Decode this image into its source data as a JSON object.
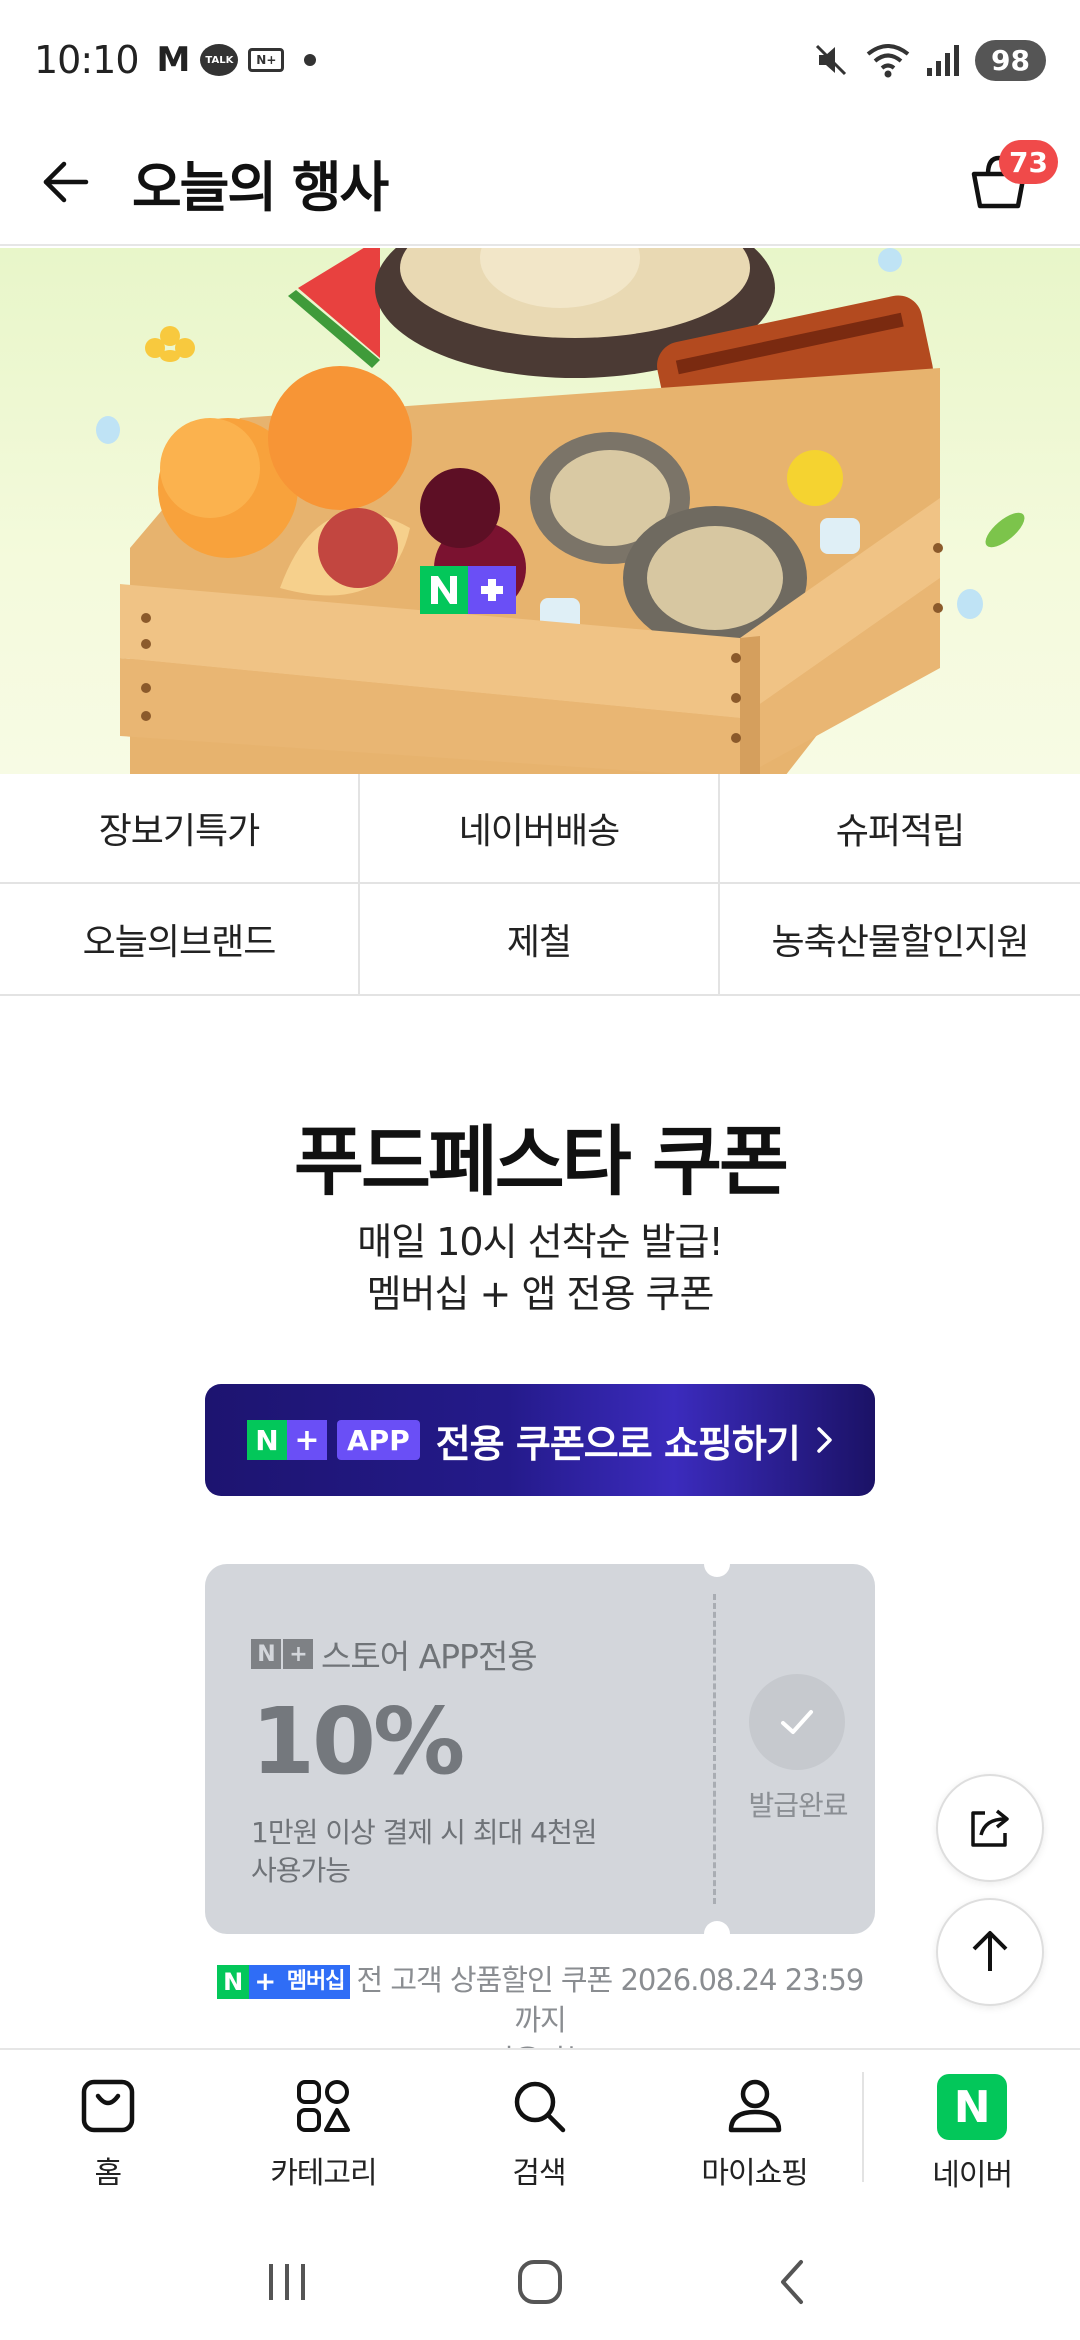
{
  "status_bar": {
    "time": "10:10",
    "app_m": "M",
    "app_talk": "TALK",
    "app_np": "N+",
    "battery": "98"
  },
  "header": {
    "title": "오늘의 행사",
    "cart_count": "73"
  },
  "categories": [
    "장보기특가",
    "네이버배송",
    "슈퍼적립",
    "오늘의브랜드",
    "제철",
    "농축산물할인지원"
  ],
  "coupon_section": {
    "title": "푸드페스타 쿠폰",
    "subtitle_line1": "매일 10시 선착순 발급!",
    "subtitle_line2": "멤버십 + 앱 전용 쿠폰",
    "app_banner": {
      "logo_n": "N",
      "logo_plus": "+",
      "chip": "APP",
      "text": "전용 쿠폰으로 쇼핑하기"
    },
    "coupon": {
      "logo_n": "N",
      "logo_plus": "+",
      "store_label": "스토어 APP전용",
      "rate": "10%",
      "condition_line1": "1만원 이상 결제 시 최대 4천원",
      "condition_line2": "사용가능",
      "issued_label": "발급완료"
    },
    "member_note": {
      "logo_n": "N",
      "logo_plus": "+",
      "logo_text": "멤버십",
      "text_line1": "전 고객 상품할인 쿠폰 2026.08.24 23:59까지",
      "text_line2": "사용가능"
    }
  },
  "bottom_nav": {
    "home": "홈",
    "category": "카테고리",
    "search": "검색",
    "my_shopping": "마이쇼핑",
    "naver": "네이버",
    "naver_logo": "N"
  },
  "colors": {
    "naver_green": "#03c75a",
    "naver_plus_purple": "#6a4ff6",
    "badge_red": "#f04a4a",
    "coupon_gray": "#d3d6db"
  }
}
